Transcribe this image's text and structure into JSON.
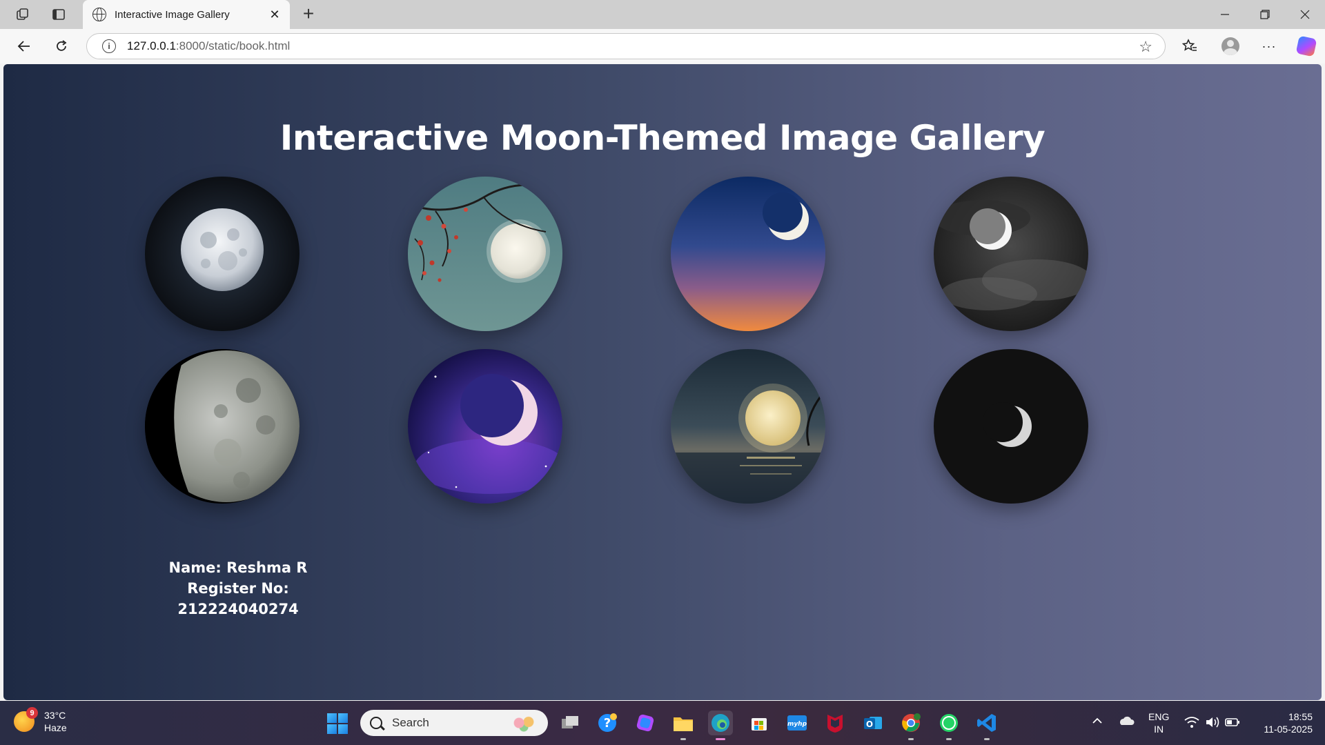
{
  "browser": {
    "tab_title": "Interactive Image Gallery",
    "url_host": "127.0.0.1",
    "url_path": ":8000/static/book.html"
  },
  "page": {
    "title": "Interactive Moon-Themed Image Gallery",
    "gallery": [
      {
        "id": "full-moon-black"
      },
      {
        "id": "full-moon-blossom-branch"
      },
      {
        "id": "crescent-sunset-sky"
      },
      {
        "id": "moon-cloudy-night"
      },
      {
        "id": "gibbous-moon-closeup"
      },
      {
        "id": "crescent-purple-nebula"
      },
      {
        "id": "full-moon-over-sea"
      },
      {
        "id": "thin-crescent-dark"
      }
    ],
    "name_line": "Name: Reshma R",
    "register_line": "Register No: 212224040274"
  },
  "taskbar": {
    "weather_temp": "33°C",
    "weather_cond": "Haze",
    "weather_badge": "9",
    "search_label": "Search",
    "lang_top": "ENG",
    "lang_bottom": "IN",
    "time": "18:55",
    "date": "11-05-2025"
  },
  "colors": {
    "page_gradient_start": "#1e2a44",
    "page_gradient_end": "#6a6e93",
    "title_text": "#ffffff"
  }
}
